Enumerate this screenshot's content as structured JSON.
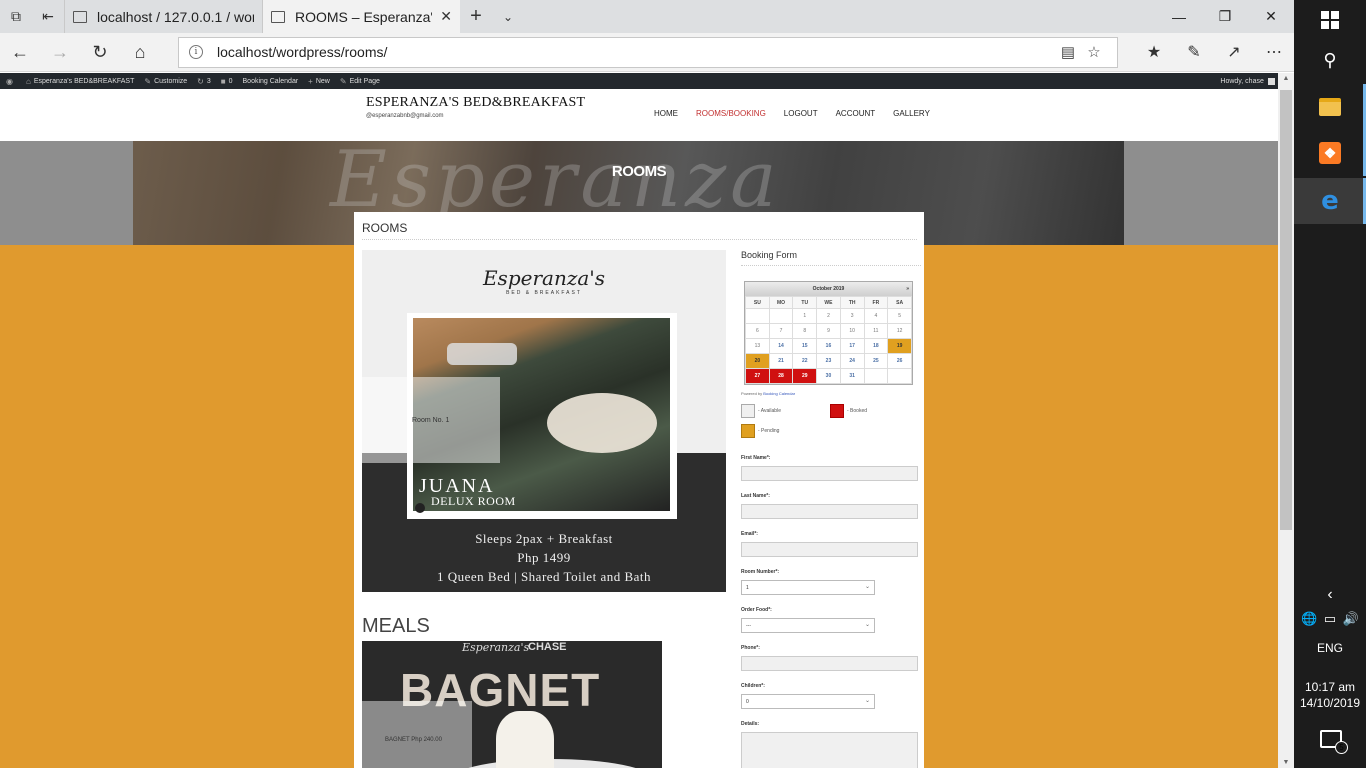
{
  "browser": {
    "tabs": [
      {
        "title": "localhost / 127.0.0.1 / wordp"
      },
      {
        "title": "ROOMS – Esperanza's B"
      }
    ],
    "url": "localhost/wordpress/rooms/"
  },
  "adminbar": {
    "items": [
      "Esperanza's BED&BREAKFAST",
      "Customize",
      "3",
      "0",
      "Booking Calendar",
      "New",
      "Edit Page"
    ],
    "greeting": "Howdy, chase"
  },
  "site": {
    "title": "ESPERANZA'S BED&BREAKFAST",
    "email": "@esperanzabnb@gmail.com",
    "menu": [
      "HOME",
      "ROOMS/BOOKING",
      "LOGOUT",
      "ACCOUNT",
      "GALLERY"
    ],
    "active_menu": "ROOMS/BOOKING"
  },
  "hero": {
    "title": "ROOMS",
    "script": "Esperanza"
  },
  "page": {
    "heading": "ROOMS"
  },
  "room_poster": {
    "brand": "Esperanza's",
    "brand_sub": "BED & BREAKFAST",
    "room_no": "Room No. 1",
    "name": "JUANA",
    "type": "DELUX ROOM",
    "line1": "Sleeps 2pax + Breakfast",
    "line2": "Php 1499",
    "line3": "1 Queen Bed | Shared Toilet and Bath"
  },
  "meals": {
    "heading": "MEALS",
    "poster_title": "BAGNET",
    "brand": "Esperanza's",
    "partner": "CHASE",
    "label": "BAGNET  Php 240.00"
  },
  "booking": {
    "title": "Booking Form",
    "calendar": {
      "month": "October 2019",
      "next": "»",
      "days": [
        "SU",
        "MO",
        "TU",
        "WE",
        "TH",
        "FR",
        "SA"
      ],
      "weeks": [
        [
          {
            "d": ""
          },
          {
            "d": ""
          },
          {
            "d": "1"
          },
          {
            "d": "2"
          },
          {
            "d": "3"
          },
          {
            "d": "4"
          },
          {
            "d": "5"
          }
        ],
        [
          {
            "d": "6"
          },
          {
            "d": "7"
          },
          {
            "d": "8"
          },
          {
            "d": "9"
          },
          {
            "d": "10"
          },
          {
            "d": "11"
          },
          {
            "d": "12"
          }
        ],
        [
          {
            "d": "13"
          },
          {
            "d": "14",
            "s": "av"
          },
          {
            "d": "15",
            "s": "av"
          },
          {
            "d": "16",
            "s": "av"
          },
          {
            "d": "17",
            "s": "av"
          },
          {
            "d": "18",
            "s": "av"
          },
          {
            "d": "19",
            "s": "pend"
          }
        ],
        [
          {
            "d": "20",
            "s": "pend"
          },
          {
            "d": "21",
            "s": "av"
          },
          {
            "d": "22",
            "s": "av"
          },
          {
            "d": "23",
            "s": "av"
          },
          {
            "d": "24",
            "s": "av"
          },
          {
            "d": "25",
            "s": "av"
          },
          {
            "d": "26",
            "s": "av"
          }
        ],
        [
          {
            "d": "27",
            "s": "book"
          },
          {
            "d": "28",
            "s": "book"
          },
          {
            "d": "29",
            "s": "book"
          },
          {
            "d": "30",
            "s": "av"
          },
          {
            "d": "31",
            "s": "av"
          },
          {
            "d": ""
          },
          {
            "d": ""
          }
        ]
      ]
    },
    "powered_prefix": "Powered by",
    "powered_link": "Booking Calendar",
    "legend": {
      "available": "- Available",
      "booked": "- Booked",
      "pending": "- Pending"
    },
    "fields": {
      "first_name": "First Name*:",
      "last_name": "Last Name*:",
      "email": "Email*:",
      "room_number": "Room Number*:",
      "room_number_value": "1",
      "order_food": "Order Food*:",
      "order_food_value": "---",
      "phone": "Phone*:",
      "children": "Children*:",
      "children_value": "0",
      "details": "Details:"
    }
  },
  "taskbar": {
    "lang": "ENG",
    "time": "10:17 am",
    "date": "14/10/2019",
    "notifications": "5"
  },
  "colors": {
    "page_bg": "#e09a2e",
    "available": "#f0f0f0",
    "booked": "#d01010",
    "pending": "#e0a020",
    "active_menu": "#c23030"
  }
}
